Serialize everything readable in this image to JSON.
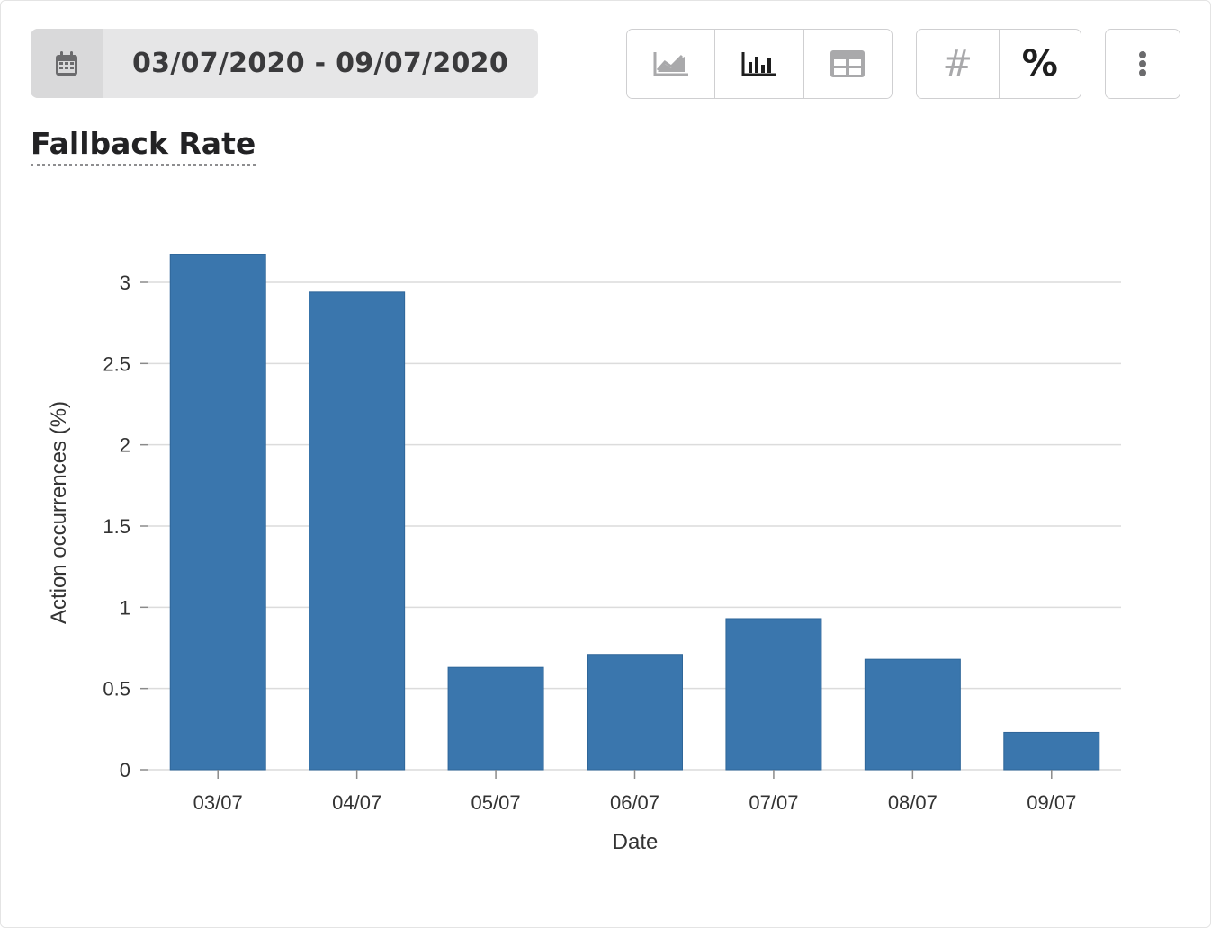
{
  "date_picker": {
    "icon": "calendar-icon",
    "range_label": "03/07/2020 - 09/07/2020"
  },
  "chart_type_buttons": [
    {
      "icon": "line-chart-icon",
      "active": false
    },
    {
      "icon": "bar-chart-icon",
      "active": true
    },
    {
      "icon": "table-icon",
      "active": false
    }
  ],
  "unit_buttons": [
    {
      "label": "#",
      "active": false
    },
    {
      "label": "%",
      "active": true
    }
  ],
  "more_button": {
    "icon": "more-vertical-icon"
  },
  "panel_title": "Fallback Rate",
  "colors": {
    "bar": "#3a76ad",
    "grid": "#dcdcdc",
    "axis": "#8a8a8a",
    "active_icon": "#1e1e1e",
    "inactive_icon": "#a9a9ab"
  },
  "chart_data": {
    "type": "bar",
    "categories": [
      "03/07",
      "04/07",
      "05/07",
      "06/07",
      "07/07",
      "08/07",
      "09/07"
    ],
    "values": [
      3.17,
      2.94,
      0.63,
      0.71,
      0.93,
      0.68,
      0.23
    ],
    "xlabel": "Date",
    "ylabel": "Action occurrences (%)",
    "ylim": [
      0,
      3
    ],
    "yticks": [
      0,
      0.5,
      1,
      1.5,
      2,
      2.5,
      3
    ],
    "ytick_labels": [
      "0",
      "0.5",
      "1",
      "1.5",
      "2",
      "2.5",
      "3"
    ],
    "grid": true,
    "legend": "none"
  }
}
